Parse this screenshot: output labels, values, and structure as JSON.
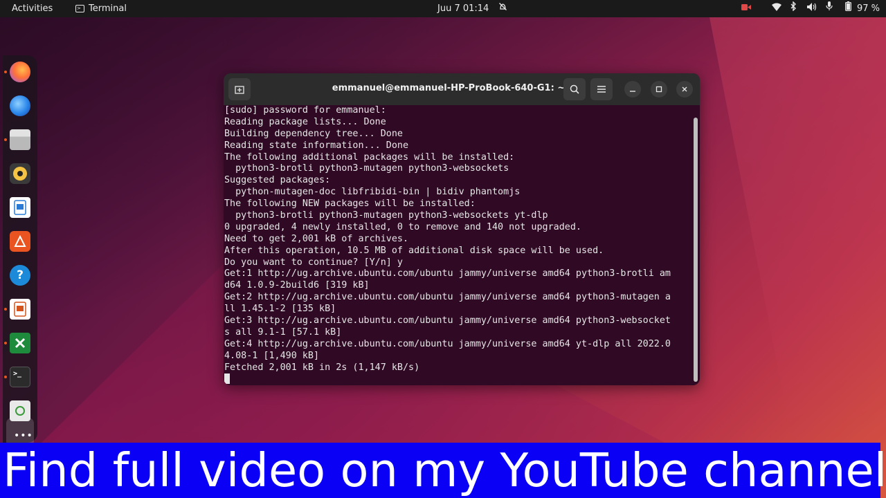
{
  "topbar": {
    "activities": "Activities",
    "app_name": "Terminal",
    "clock": "Juu 7  01:14",
    "battery_pct": "97 %"
  },
  "dock": {
    "items": [
      "firefox-icon",
      "thunderbird-icon",
      "files-icon",
      "rhythmbox-icon",
      "writer-icon",
      "app-center-icon",
      "help-icon",
      "impress-icon",
      "calc-icon",
      "terminal-icon",
      "trash-icon"
    ]
  },
  "window": {
    "title": "emmanuel@emmanuel-HP-ProBook-640-G1: ~",
    "lines": [
      "[sudo] password for emmanuel:",
      "Reading package lists... Done",
      "Building dependency tree... Done",
      "Reading state information... Done",
      "The following additional packages will be installed:",
      "  python3-brotli python3-mutagen python3-websockets",
      "Suggested packages:",
      "  python-mutagen-doc libfribidi-bin | bidiv phantomjs",
      "The following NEW packages will be installed:",
      "  python3-brotli python3-mutagen python3-websockets yt-dlp",
      "0 upgraded, 4 newly installed, 0 to remove and 140 not upgraded.",
      "Need to get 2,001 kB of archives.",
      "After this operation, 10.5 MB of additional disk space will be used.",
      "Do you want to continue? [Y/n] y",
      "Get:1 http://ug.archive.ubuntu.com/ubuntu jammy/universe amd64 python3-brotli am",
      "d64 1.0.9-2build6 [319 kB]",
      "Get:2 http://ug.archive.ubuntu.com/ubuntu jammy/universe amd64 python3-mutagen a",
      "ll 1.45.1-2 [135 kB]",
      "Get:3 http://ug.archive.ubuntu.com/ubuntu jammy/universe amd64 python3-websocket",
      "s all 9.1-1 [57.1 kB]",
      "Get:4 http://ug.archive.ubuntu.com/ubuntu jammy/universe amd64 yt-dlp all 2022.0",
      "4.08-1 [1,490 kB]",
      "Fetched 2,001 kB in 2s (1,147 kB/s)"
    ]
  },
  "banner": {
    "text": "Find full video on my YouTube channel"
  }
}
